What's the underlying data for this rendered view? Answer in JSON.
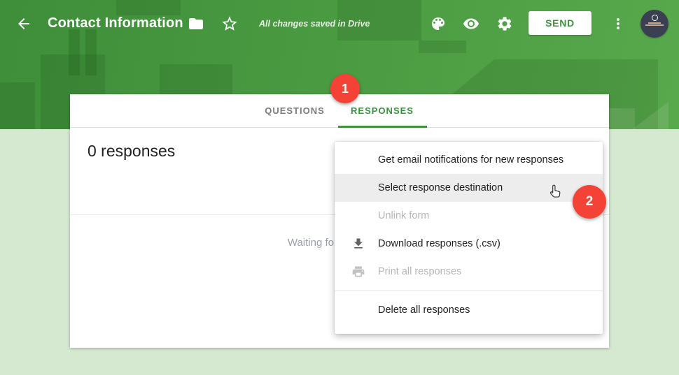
{
  "header": {
    "title": "Contact Information",
    "saved_status": "All changes saved in Drive",
    "send_label": "SEND"
  },
  "tabs": {
    "questions": "QUESTIONS",
    "responses": "RESPONSES",
    "active": "RESPONSES"
  },
  "panel": {
    "count": "0 responses",
    "waiting_clipped": "Waiting fo"
  },
  "menu": {
    "items": [
      {
        "label": "Get email notifications for new responses",
        "state": "enabled",
        "icon": null
      },
      {
        "label": "Select response destination",
        "state": "highlighted",
        "icon": null
      },
      {
        "label": "Unlink form",
        "state": "disabled",
        "icon": null
      },
      {
        "label": "Download responses (.csv)",
        "state": "enabled",
        "icon": "download-icon"
      },
      {
        "label": "Print all responses",
        "state": "disabled",
        "icon": "print-icon"
      },
      {
        "label": "Delete all responses",
        "state": "enabled",
        "icon": null
      }
    ]
  },
  "annotations": {
    "step1": "1",
    "step2": "2"
  },
  "icons": {
    "back": "arrow-left",
    "folder": "folder",
    "star": "star-outline",
    "theme": "palette",
    "preview": "eye",
    "settings": "gear",
    "more": "vertical-dots",
    "download": "download-arrow-tray",
    "print": "printer",
    "cursor": "hand-pointer"
  },
  "colors": {
    "header_green": "#4c9c43",
    "background_green": "#d5e8d0",
    "accent_green": "#3d9140",
    "badge_red": "#f44336",
    "disabled_text": "#b6b6b6"
  }
}
